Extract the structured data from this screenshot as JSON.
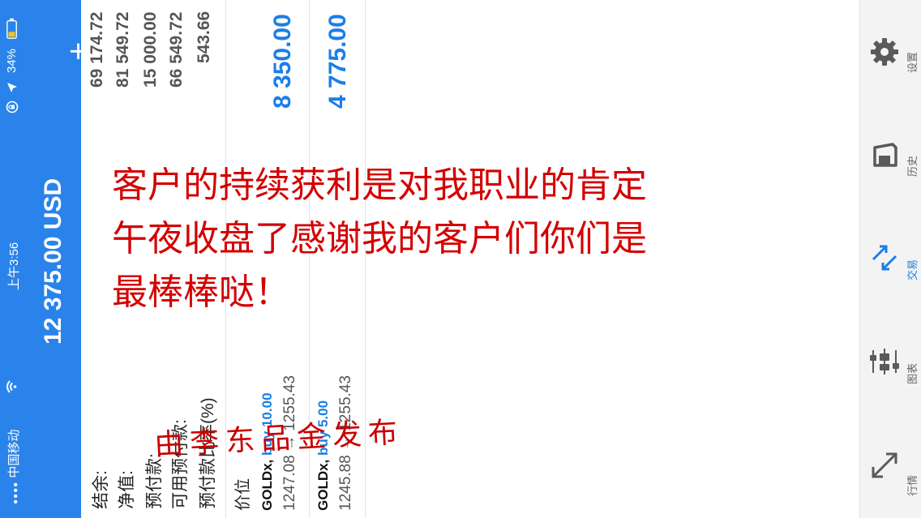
{
  "status_bar": {
    "signal": "●●●●",
    "carrier": "中国移动",
    "wifi_icon": "wifi-icon",
    "time": "上午3:56",
    "location_icon": "location-arrow-icon",
    "battery_percent": "34%",
    "battery_level": 0.34
  },
  "header": {
    "balance_title": "12 375.00 USD",
    "add_label": "+"
  },
  "account": {
    "rows": [
      {
        "label": "结余:",
        "value": "69 174.72"
      },
      {
        "label": "净值:",
        "value": "81 549.72"
      },
      {
        "label": "预付款:",
        "value": "15 000.00"
      },
      {
        "label": "可用预付款:",
        "value": "66 549.72"
      },
      {
        "label": "预付款比率(%)",
        "value": "543.66"
      }
    ]
  },
  "positions": {
    "header_label": "价位",
    "items": [
      {
        "symbol": "GOLDx,",
        "side": "buy 10.00",
        "prices": "1247.08 → 1255.43",
        "profit": "8 350.00"
      },
      {
        "symbol": "GOLDx,",
        "side": "buy 5.00",
        "prices": "1245.88 → 1255.43",
        "profit": "4 775.00"
      }
    ]
  },
  "overlay": {
    "line1": "客户的持续获利是对我职业的肯定",
    "line2": "午夜收盘了感谢我的客户们你们是",
    "line3": "最棒棒哒！",
    "signature": "由李东品金发布"
  },
  "nav": {
    "items": [
      {
        "label": "设置",
        "icon": "gear-icon"
      },
      {
        "label": "历史",
        "icon": "history-icon"
      },
      {
        "label": "交易",
        "icon": "trade-icon"
      },
      {
        "label": "图表",
        "icon": "chart-candles-icon"
      },
      {
        "label": "行情",
        "icon": "quotes-icon"
      }
    ],
    "active": "交易"
  },
  "colors": {
    "primary": "#2a83ea",
    "accent_blue": "#1a7ee8",
    "overlay_red": "#d40000"
  }
}
